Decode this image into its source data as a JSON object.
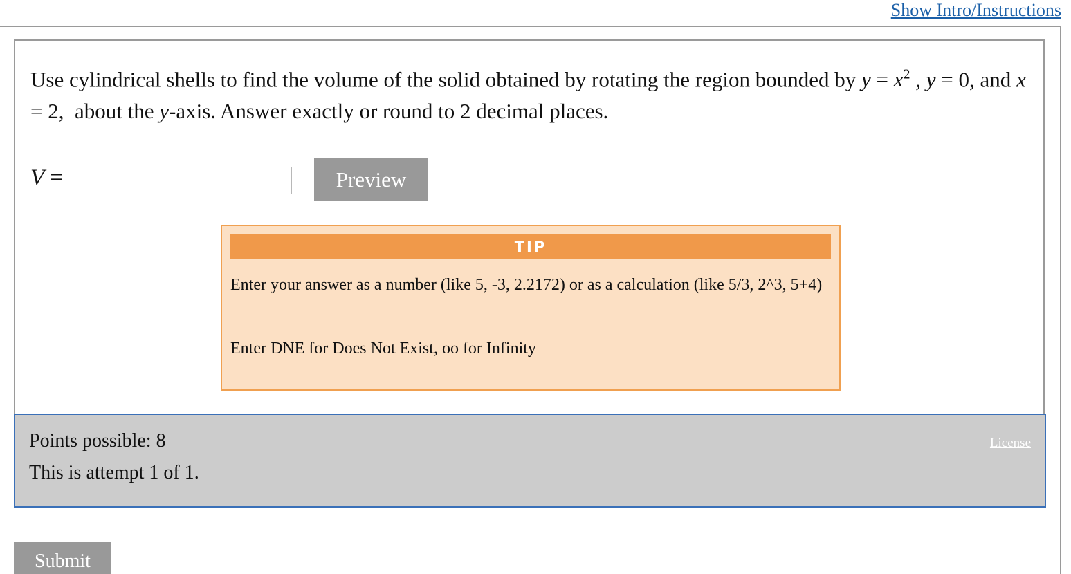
{
  "header": {
    "intro_link": "Show Intro/Instructions"
  },
  "question": {
    "text_part1": "Use cylindrical shells to find the volume of the solid obtained by rotating the region bounded by ",
    "y1": "y",
    "eq1": " = ",
    "x1": "x",
    "exp1": "2",
    "sep1": " , ",
    "y2": "y",
    "eq2": " = 0,",
    "text_part2": " and ",
    "x2": "x",
    "eq3": " = 2,",
    "text_part3": "  about the ",
    "y3": "y",
    "text_part4": "-axis. Answer exactly or round to 2 decimal places."
  },
  "answer": {
    "label_var": "V",
    "label_eq": " =",
    "input_value": "",
    "preview_label": "Preview"
  },
  "tip": {
    "header": "TIP",
    "line1": "Enter your answer as a number (like 5, -3, 2.2172) or as a calculation (like 5/3, 2^3, 5+4)",
    "line2": "Enter DNE for Does Not Exist, oo for Infinity"
  },
  "footer": {
    "points": "Points possible: 8",
    "attempt": "This is attempt 1 of 1.",
    "license": "License"
  },
  "submit": {
    "label": "Submit"
  }
}
